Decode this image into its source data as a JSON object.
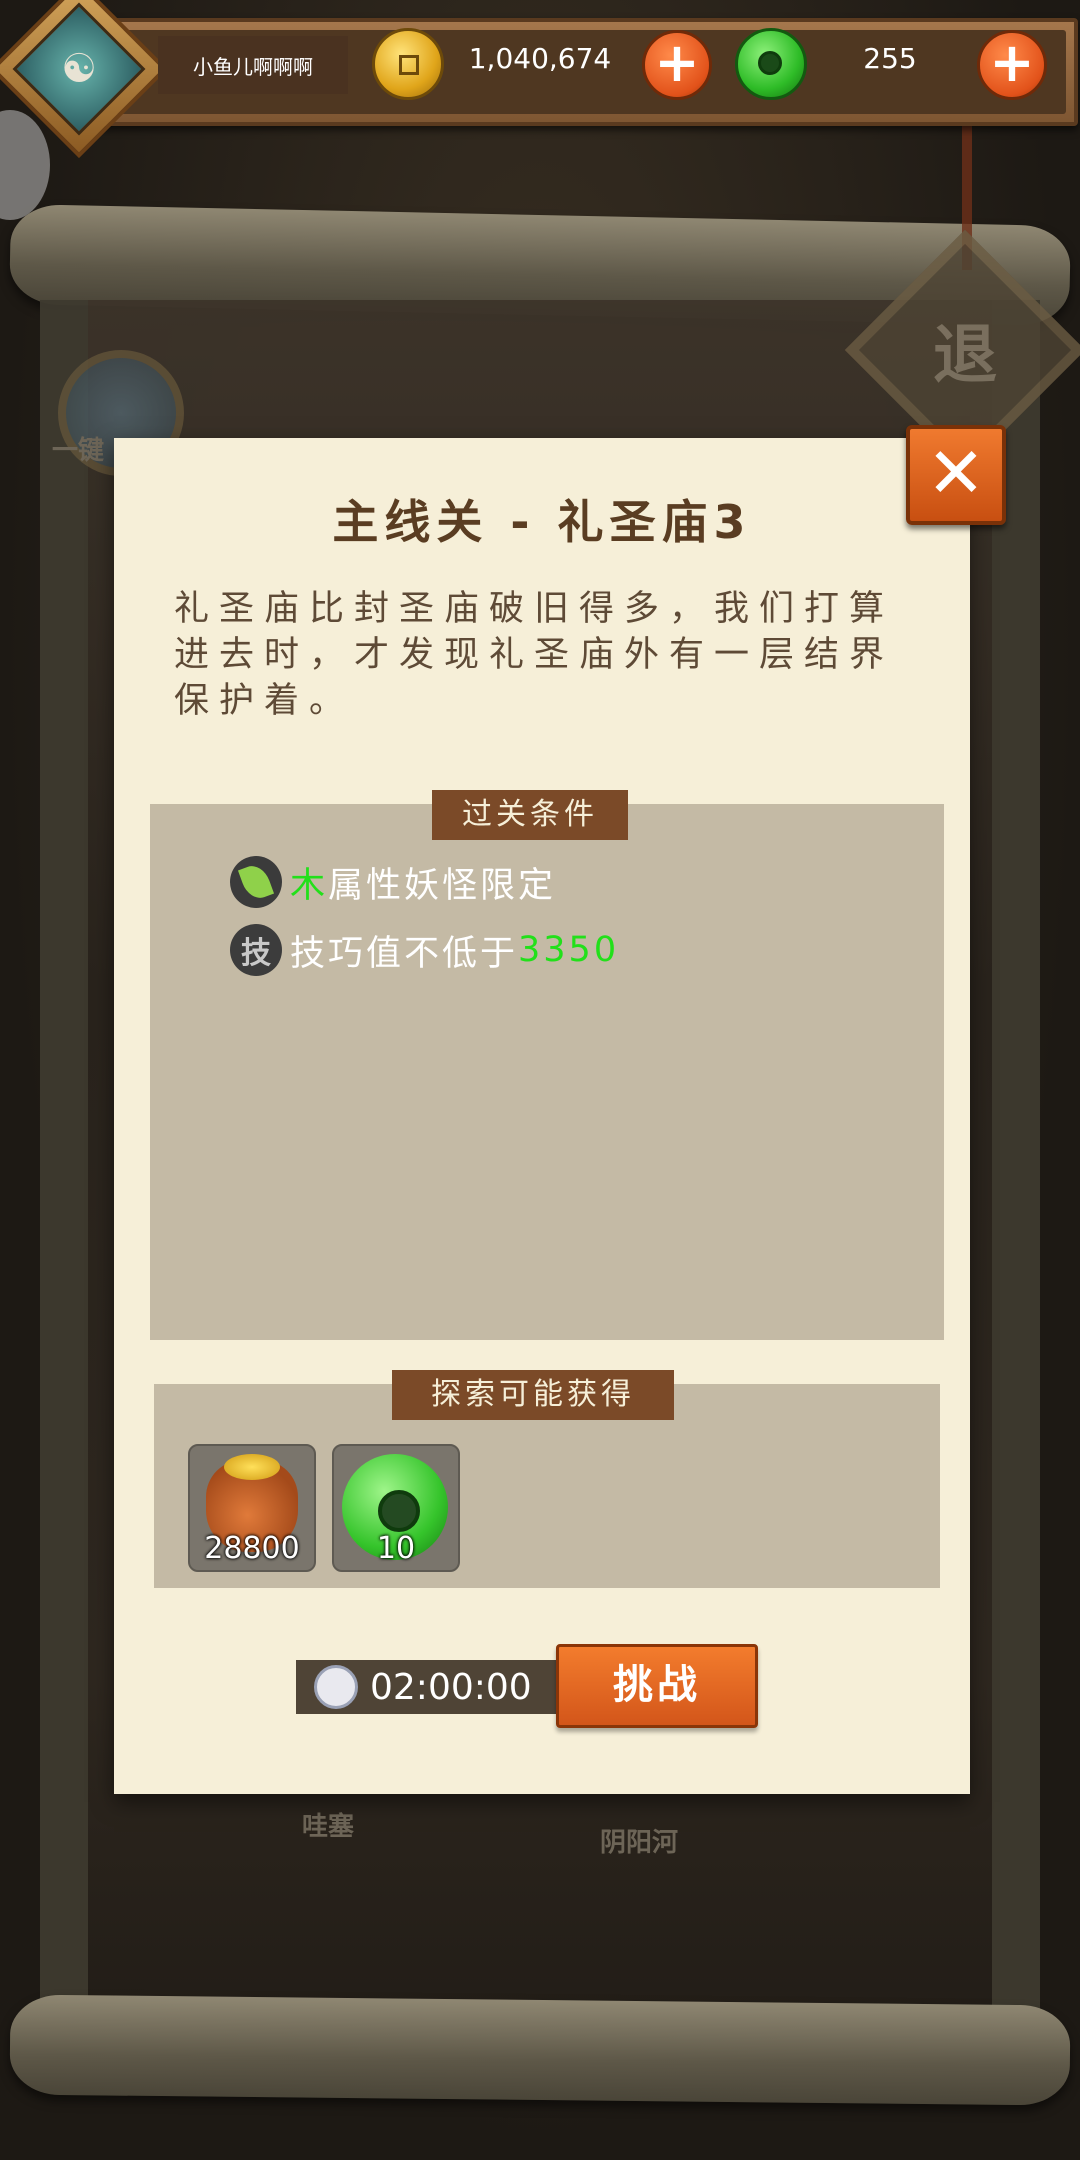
{
  "header": {
    "player_name": "小鱼儿啊啊啊",
    "coins": "1,040,674",
    "jade": "255",
    "plus": "+"
  },
  "background": {
    "map_labels": [
      "一键",
      "哇塞",
      "阴阳河"
    ],
    "exit_label": "退"
  },
  "dialog": {
    "title": "主线关 - 礼圣庙3",
    "description": "礼圣庙比封圣庙破旧得多，我们打算进去时，才发现礼圣庙外有一层结界保护着。",
    "conditions_title": "过关条件",
    "conditions": [
      {
        "icon": "wood-leaf-icon",
        "highlight": "木",
        "text": "属性妖怪限定"
      },
      {
        "icon_text": "技",
        "text": "技巧值不低于",
        "highlight": "3350"
      }
    ],
    "rewards_title": "探索可能获得",
    "rewards": [
      {
        "icon": "coin-bag-icon",
        "count": "28800"
      },
      {
        "icon": "jade-ring-icon",
        "count": "10"
      }
    ],
    "timer": "02:00:00",
    "challenge_label": "挑战",
    "close_label": "✕"
  },
  "colors": {
    "panel": "#f6efd8",
    "section": "#c4baa5",
    "tab": "#7b4a28",
    "accent_orange": "#e2521a",
    "highlight_green": "#22e01a"
  }
}
